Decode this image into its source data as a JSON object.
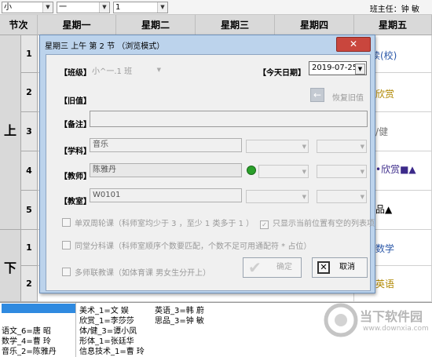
{
  "toolbar": {
    "combo1": "小",
    "combo2": "一",
    "combo3": "1",
    "teacher_label": "班主任：钟 敏"
  },
  "timetable": {
    "col_header": "节次",
    "days": [
      "星期一",
      "星期二",
      "星期三",
      "星期四",
      "星期五"
    ],
    "sections": [
      "上",
      "下"
    ],
    "periods": [
      "1",
      "2",
      "3",
      "4",
      "5",
      "1",
      "2"
    ],
    "friday": [
      "读(校)",
      "欣赏",
      "/健",
      "•欣赏■▲",
      "品▲",
      "数学",
      "英语"
    ]
  },
  "bottom_list": {
    "items": [
      "美术_1=文 娱",
      "英语_3=韩 蔚",
      "欣赏_1=李莎莎",
      "思品_3=钟 敏",
      "语文_6=唐 昭",
      "体/健_3=谭小凤",
      "数学_4=曹 玲",
      "形体_1=张廷华",
      "音乐_2=陈雅丹",
      "信息技术_1=曹 玲"
    ]
  },
  "dialog": {
    "title": "星期三 上午 第 2 节 （浏览模式）",
    "close": "✕",
    "class_label": "【班级】",
    "class_value": "小^一.1 班",
    "date_label": "【今天日期】",
    "date_value": "2019-07-25",
    "old_label": "【旧值】",
    "restore_label": "恢复旧值",
    "note_label": "【备注】",
    "subject_label": "【学科】",
    "subject_value": "音乐",
    "teacher_label": "【教师】",
    "teacher_value": "陈雅丹",
    "room_label": "【教室】",
    "room_value": "W0101",
    "chk_single": "单双周轮课（科师室均少于 3 ，至少 1 类多于 1 ）",
    "chk_show_empty": "只显示当前位置有空的列表项",
    "chk_parallel": "同堂分科课（科师室顺序个数要匹配，个数不足可用通配符 * 占位）",
    "chk_multi": "多师联教课（如体育课 男女生分开上）",
    "ok": "确定",
    "cancel": "取消",
    "indicator_color": "#2aa02a"
  },
  "watermark": {
    "brand": "当下软件园",
    "url": "www.downxia.com"
  }
}
